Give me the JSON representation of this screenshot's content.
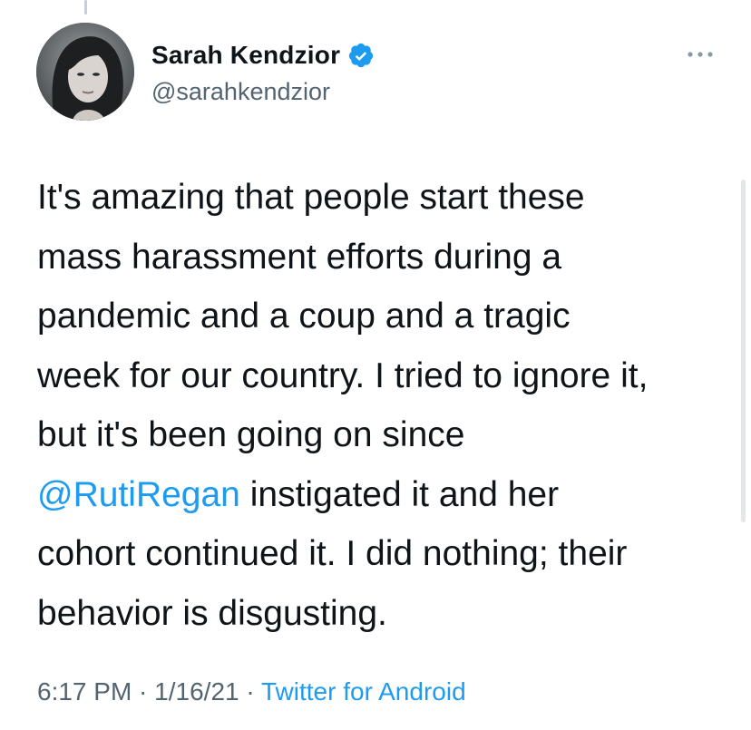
{
  "author": {
    "display_name": "Sarah Kendzior",
    "handle": "@sarahkendzior",
    "verified": true,
    "avatar_icon": "profile-photo"
  },
  "tweet": {
    "lines": [
      "It's amazing that people start these",
      "mass harassment efforts during a",
      "pandemic and a coup and a tragic",
      "week for our country. I tried to ignore it,",
      "but it's been going on since"
    ],
    "mention": "@RutiRegan",
    "mention_suffix": " instigated it and her",
    "lines_after": [
      "cohort continued it. I did nothing; their",
      "behavior is disgusting."
    ]
  },
  "meta": {
    "time": "6:17 PM",
    "separator": " · ",
    "date": "1/16/21",
    "source": "Twitter for Android"
  },
  "colors": {
    "link": "#1d9bf0",
    "text": "#0f1419",
    "secondary": "#536471"
  },
  "icons": {
    "verified": "verified-badge-icon",
    "more": "more-options-icon"
  }
}
